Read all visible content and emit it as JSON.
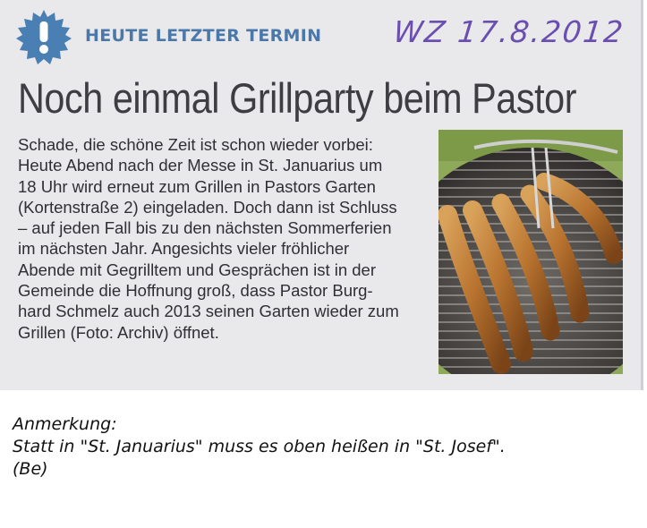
{
  "clipping": {
    "kicker": "HEUTE LETZTER TERMIN",
    "handwritten_date": "WZ 17.8.2012",
    "headline": "Noch einmal Grillparty beim Pastor",
    "body_lines": [
      "Schade, die schöne Zeit ist schon wieder vorbei:",
      "Heute Abend nach der Messe in St. Januarius um",
      "18 Uhr wird erneut zum Grillen in Pastors Garten",
      "(Kortenstraße 2) eingeladen. Doch dann ist Schluss",
      "– auf jeden Fall bis zu den nächsten Sommerferien",
      "im nächsten Jahr. Angesichts vieler fröhlicher",
      "Abende mit Gegrilltem und Gesprächen ist in der",
      "Gemeinde die Hoffnung groß, dass Pastor Burg-",
      "hard Schmelz auch 2013 seinen Garten wieder zum",
      "Grillen (Foto: Archiv) öffnet."
    ]
  },
  "note": {
    "label": "Anmerkung:",
    "line1": "Statt in \"St. Januarius\" muss es oben heißen in \"St. Josef\".",
    "line2": "(Be)"
  },
  "colors": {
    "kicker": "#4a78a8",
    "handwriting": "#6b4fb0",
    "paper": "#e9e9ec"
  },
  "icons": {
    "badge": "exclamation-burst-icon",
    "photo": "grilled-sausages-photo"
  }
}
